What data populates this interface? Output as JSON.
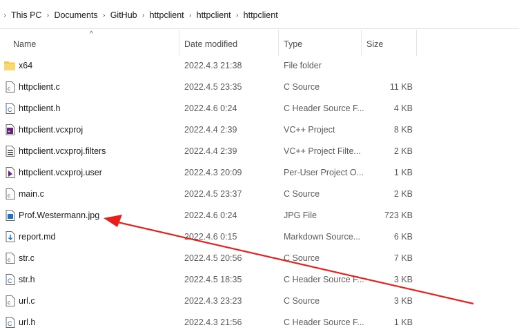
{
  "breadcrumb": [
    "This PC",
    "Documents",
    "GitHub",
    "httpclient",
    "httpclient",
    "httpclient"
  ],
  "columns": {
    "name": "Name",
    "date": "Date modified",
    "type": "Type",
    "size": "Size"
  },
  "files": [
    {
      "name": "x64",
      "date": "2022.4.3 21:38",
      "type": "File folder",
      "size": "",
      "icon": "folder-icon"
    },
    {
      "name": "httpclient.c",
      "date": "2022.4.5 23:35",
      "type": "C Source",
      "size": "11 KB",
      "icon": "c-source-file-icon"
    },
    {
      "name": "httpclient.h",
      "date": "2022.4.6 0:24",
      "type": "C Header Source F...",
      "size": "4 KB",
      "icon": "c-header-file-icon"
    },
    {
      "name": "httpclient.vcxproj",
      "date": "2022.4.4 2:39",
      "type": "VC++ Project",
      "size": "8 KB",
      "icon": "vcxproj-file-icon"
    },
    {
      "name": "httpclient.vcxproj.filters",
      "date": "2022.4.4 2:39",
      "type": "VC++ Project Filte...",
      "size": "2 KB",
      "icon": "filters-file-icon"
    },
    {
      "name": "httpclient.vcxproj.user",
      "date": "2022.4.3 20:09",
      "type": "Per-User Project O...",
      "size": "1 KB",
      "icon": "user-project-file-icon"
    },
    {
      "name": "main.c",
      "date": "2022.4.5 23:37",
      "type": "C Source",
      "size": "2 KB",
      "icon": "c-source-file-icon"
    },
    {
      "name": "Prof.Westermann.jpg",
      "date": "2022.4.6 0:24",
      "type": "JPG File",
      "size": "723 KB",
      "icon": "image-file-icon"
    },
    {
      "name": "report.md",
      "date": "2022.4.6 0:15",
      "type": "Markdown Source...",
      "size": "6 KB",
      "icon": "markdown-file-icon"
    },
    {
      "name": "str.c",
      "date": "2022.4.5 20:56",
      "type": "C Source",
      "size": "7 KB",
      "icon": "c-source-file-icon"
    },
    {
      "name": "str.h",
      "date": "2022.4.5 18:35",
      "type": "C Header Source F...",
      "size": "3 KB",
      "icon": "c-header-file-icon"
    },
    {
      "name": "url.c",
      "date": "2022.4.3 23:23",
      "type": "C Source",
      "size": "3 KB",
      "icon": "c-source-file-icon"
    },
    {
      "name": "url.h",
      "date": "2022.4.3 21:56",
      "type": "C Header Source F...",
      "size": "1 KB",
      "icon": "c-header-file-icon"
    }
  ],
  "colors": {
    "annotation_arrow": "#e8201b",
    "folder": "#f4c54b"
  }
}
